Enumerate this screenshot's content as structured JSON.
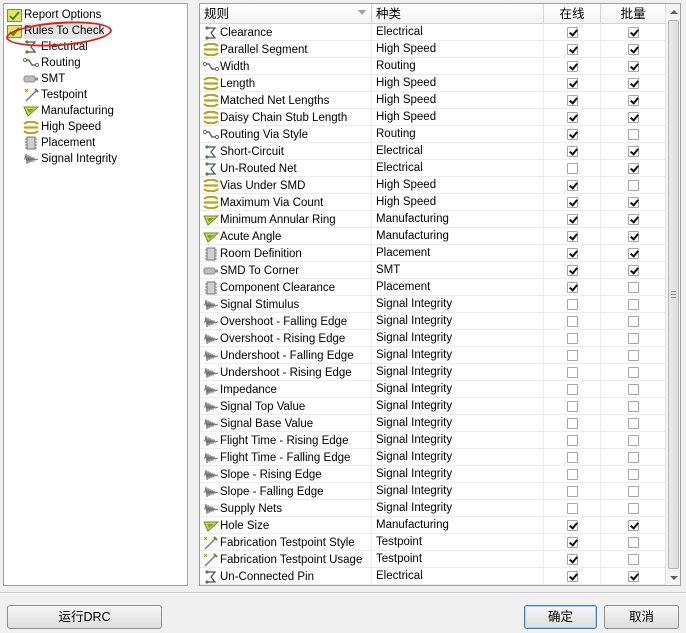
{
  "tree": {
    "items": [
      {
        "label": "Report Options",
        "icon": "report-options-icon"
      },
      {
        "label": "Rules To Check",
        "icon": "rules-to-check-icon"
      },
      {
        "label": "Electrical",
        "icon": "electrical-icon"
      },
      {
        "label": "Routing",
        "icon": "routing-icon"
      },
      {
        "label": "SMT",
        "icon": "smt-icon"
      },
      {
        "label": "Testpoint",
        "icon": "testpoint-icon"
      },
      {
        "label": "Manufacturing",
        "icon": "manufacturing-icon"
      },
      {
        "label": "High Speed",
        "icon": "high-speed-icon"
      },
      {
        "label": "Placement",
        "icon": "placement-icon"
      },
      {
        "label": "Signal Integrity",
        "icon": "signal-integrity-icon"
      }
    ],
    "selected_index": 1
  },
  "grid": {
    "headers": {
      "rule": "规则",
      "kind": "种类",
      "online": "在线",
      "batch": "批量"
    },
    "rows": [
      {
        "rule": "Clearance",
        "kind": "Electrical",
        "online": true,
        "batch": true
      },
      {
        "rule": "Parallel Segment",
        "kind": "High Speed",
        "online": true,
        "batch": true
      },
      {
        "rule": "Width",
        "kind": "Routing",
        "online": true,
        "batch": true
      },
      {
        "rule": "Length",
        "kind": "High Speed",
        "online": true,
        "batch": true
      },
      {
        "rule": "Matched Net Lengths",
        "kind": "High Speed",
        "online": true,
        "batch": true
      },
      {
        "rule": "Daisy Chain Stub Length",
        "kind": "High Speed",
        "online": true,
        "batch": true
      },
      {
        "rule": "Routing Via Style",
        "kind": "Routing",
        "online": true,
        "batch": false
      },
      {
        "rule": "Short-Circuit",
        "kind": "Electrical",
        "online": true,
        "batch": true
      },
      {
        "rule": "Un-Routed Net",
        "kind": "Electrical",
        "online": false,
        "batch": true
      },
      {
        "rule": "Vias Under SMD",
        "kind": "High Speed",
        "online": true,
        "batch": false
      },
      {
        "rule": "Maximum Via Count",
        "kind": "High Speed",
        "online": true,
        "batch": true
      },
      {
        "rule": "Minimum Annular Ring",
        "kind": "Manufacturing",
        "online": true,
        "batch": true
      },
      {
        "rule": "Acute Angle",
        "kind": "Manufacturing",
        "online": true,
        "batch": true
      },
      {
        "rule": "Room Definition",
        "kind": "Placement",
        "online": true,
        "batch": true
      },
      {
        "rule": "SMD To Corner",
        "kind": "SMT",
        "online": true,
        "batch": true
      },
      {
        "rule": "Component Clearance",
        "kind": "Placement",
        "online": true,
        "batch": false
      },
      {
        "rule": "Signal Stimulus",
        "kind": "Signal Integrity",
        "online": false,
        "batch": false
      },
      {
        "rule": "Overshoot - Falling Edge",
        "kind": "Signal Integrity",
        "online": false,
        "batch": false
      },
      {
        "rule": "Overshoot - Rising Edge",
        "kind": "Signal Integrity",
        "online": false,
        "batch": false
      },
      {
        "rule": "Undershoot - Falling Edge",
        "kind": "Signal Integrity",
        "online": false,
        "batch": false
      },
      {
        "rule": "Undershoot - Rising Edge",
        "kind": "Signal Integrity",
        "online": false,
        "batch": false
      },
      {
        "rule": "Impedance",
        "kind": "Signal Integrity",
        "online": false,
        "batch": false
      },
      {
        "rule": "Signal Top Value",
        "kind": "Signal Integrity",
        "online": false,
        "batch": false
      },
      {
        "rule": "Signal Base Value",
        "kind": "Signal Integrity",
        "online": false,
        "batch": false
      },
      {
        "rule": "Flight Time - Rising Edge",
        "kind": "Signal Integrity",
        "online": false,
        "batch": false
      },
      {
        "rule": "Flight Time - Falling Edge",
        "kind": "Signal Integrity",
        "online": false,
        "batch": false
      },
      {
        "rule": "Slope - Rising Edge",
        "kind": "Signal Integrity",
        "online": false,
        "batch": false
      },
      {
        "rule": "Slope - Falling Edge",
        "kind": "Signal Integrity",
        "online": false,
        "batch": false
      },
      {
        "rule": "Supply Nets",
        "kind": "Signal Integrity",
        "online": false,
        "batch": false
      },
      {
        "rule": "Hole Size",
        "kind": "Manufacturing",
        "online": true,
        "batch": true
      },
      {
        "rule": "Fabrication Testpoint Style",
        "kind": "Testpoint",
        "online": true,
        "batch": false
      },
      {
        "rule": "Fabrication Testpoint Usage",
        "kind": "Testpoint",
        "online": true,
        "batch": false
      },
      {
        "rule": "Un-Connected Pin",
        "kind": "Electrical",
        "online": true,
        "batch": true
      }
    ]
  },
  "buttons": {
    "run_drc": "运行DRC",
    "ok": "确定",
    "cancel": "取消"
  },
  "colors": {
    "annotation_oval": "#e0201c",
    "window_bg": "#f0f0f0"
  }
}
